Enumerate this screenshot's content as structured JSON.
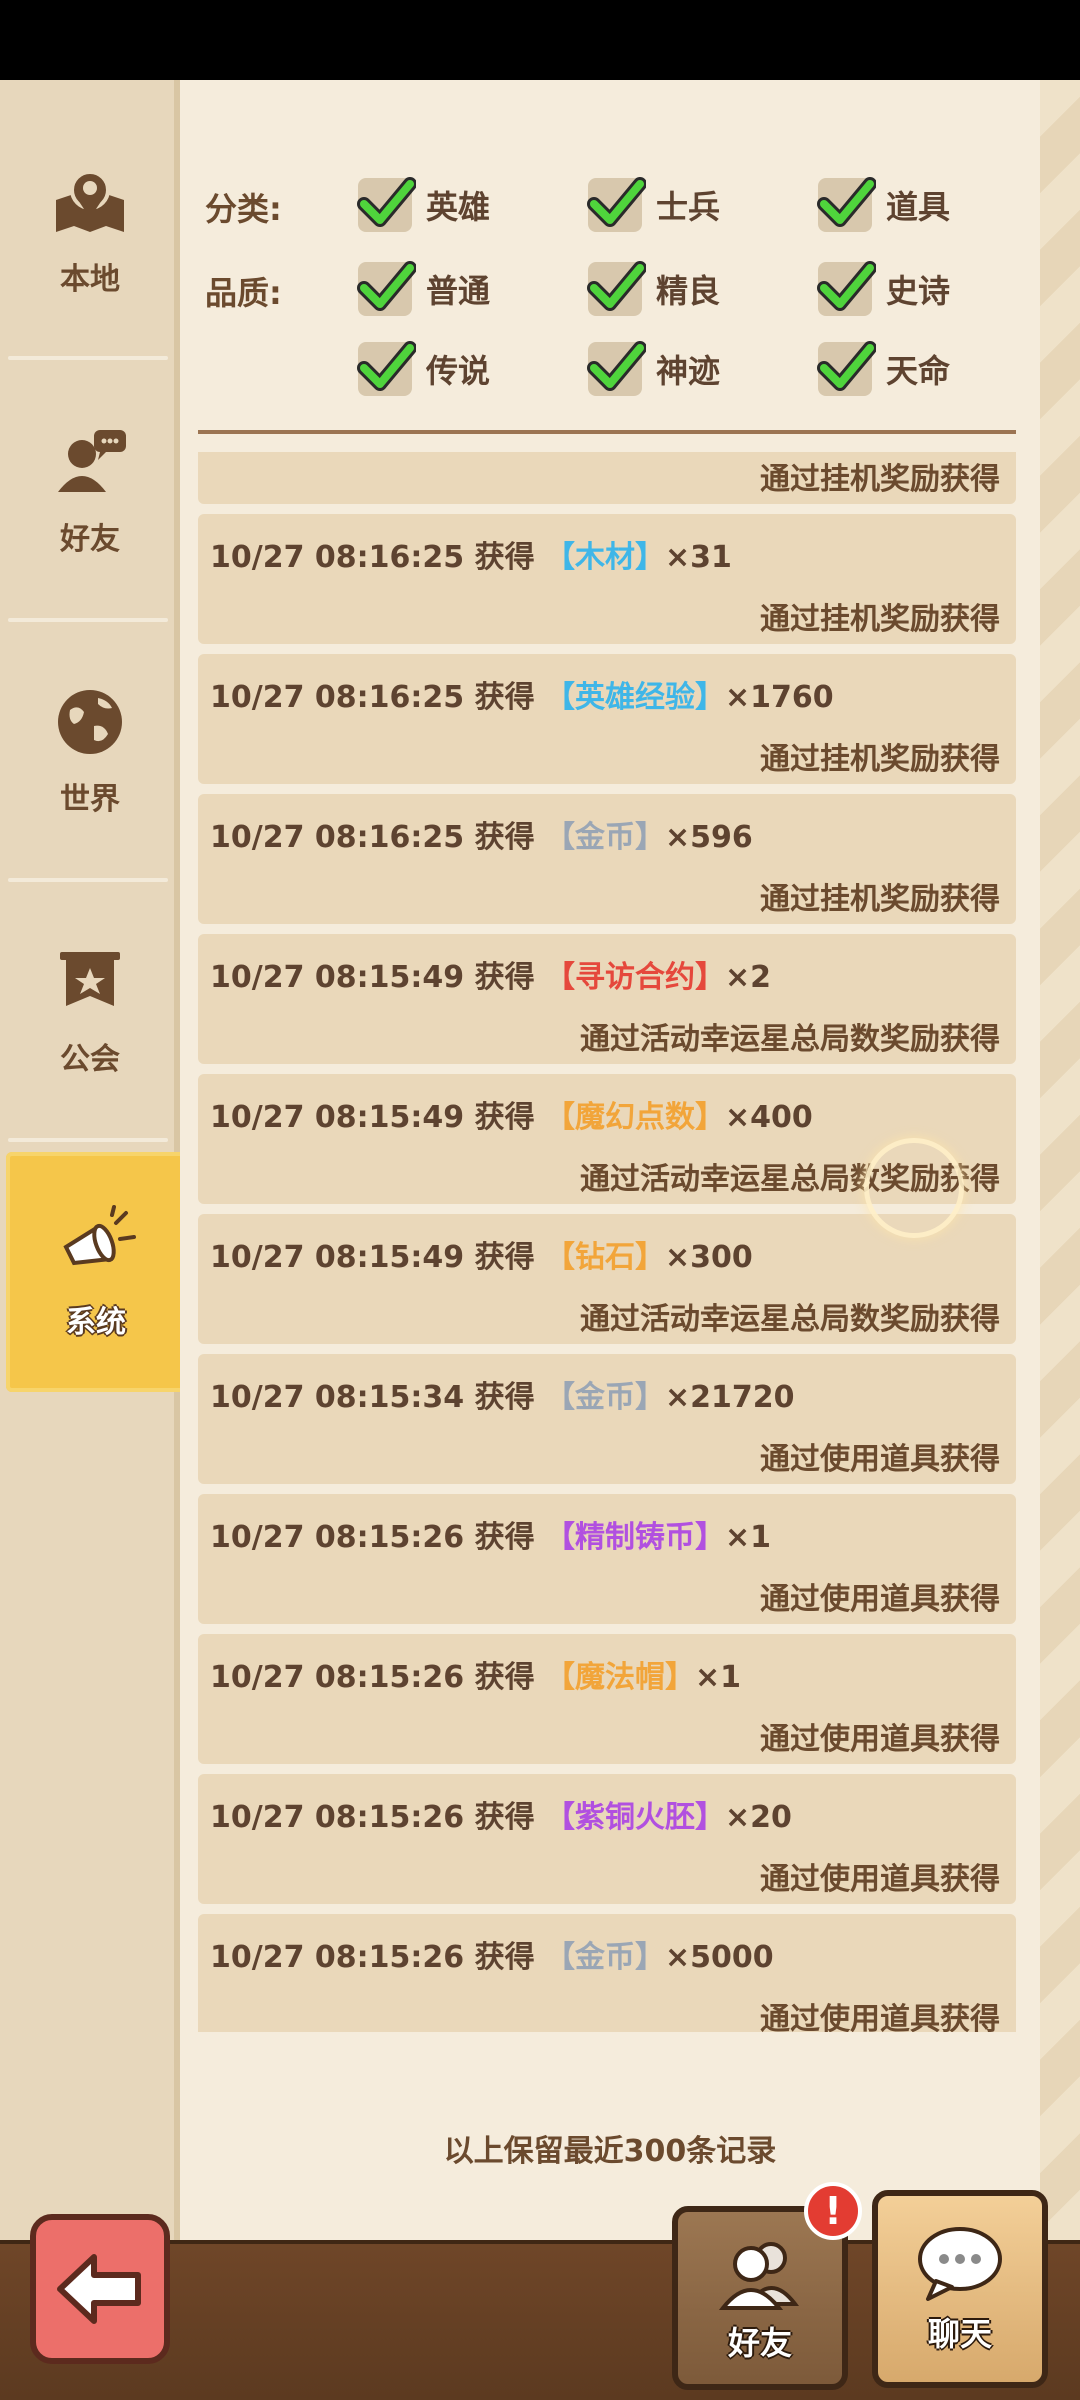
{
  "sidebar": {
    "tabs": [
      {
        "label": "本地",
        "icon": "map-pin-icon"
      },
      {
        "label": "好友",
        "icon": "friend-chat-icon"
      },
      {
        "label": "世界",
        "icon": "globe-icon"
      },
      {
        "label": "公会",
        "icon": "guild-banner-icon"
      },
      {
        "label": "系统",
        "icon": "megaphone-icon",
        "active": true
      }
    ]
  },
  "filters": {
    "category_label": "分类:",
    "quality_label": "品质:",
    "categories": [
      "英雄",
      "士兵",
      "道具"
    ],
    "qualities": [
      "普通",
      "精良",
      "史诗",
      "传说",
      "神迹",
      "天命"
    ]
  },
  "log": {
    "partial_top_source": "通过挂机奖励获得",
    "entries": [
      {
        "time": "10/27 08:16:25",
        "verb": "获得",
        "item": "【木材】",
        "item_color": "#3fb6e8",
        "qty": "×31",
        "source": "通过挂机奖励获得"
      },
      {
        "time": "10/27 08:16:25",
        "verb": "获得",
        "item": "【英雄经验】",
        "item_color": "#3fb6e8",
        "qty": "×1760",
        "source": "通过挂机奖励获得"
      },
      {
        "time": "10/27 08:16:25",
        "verb": "获得",
        "item": "【金币】",
        "item_color": "#9aa6b5",
        "qty": "×596",
        "source": "通过挂机奖励获得"
      },
      {
        "time": "10/27 08:15:49",
        "verb": "获得",
        "item": "【寻访合约】",
        "item_color": "#e5483c",
        "qty": "×2",
        "source": "通过活动幸运星总局数奖励获得"
      },
      {
        "time": "10/27 08:15:49",
        "verb": "获得",
        "item": "【魔幻点数】",
        "item_color": "#f2a53a",
        "qty": "×400",
        "source": "通过活动幸运星总局数奖励获得"
      },
      {
        "time": "10/27 08:15:49",
        "verb": "获得",
        "item": "【钻石】",
        "item_color": "#f2a53a",
        "qty": "×300",
        "source": "通过活动幸运星总局数奖励获得"
      },
      {
        "time": "10/27 08:15:34",
        "verb": "获得",
        "item": "【金币】",
        "item_color": "#9aa6b5",
        "qty": "×21720",
        "source": "通过使用道具获得"
      },
      {
        "time": "10/27 08:15:26",
        "verb": "获得",
        "item": "【精制铸币】",
        "item_color": "#b150e0",
        "qty": "×1",
        "source": "通过使用道具获得"
      },
      {
        "time": "10/27 08:15:26",
        "verb": "获得",
        "item": "【魔法帽】",
        "item_color": "#f2a53a",
        "qty": "×1",
        "source": "通过使用道具获得"
      },
      {
        "time": "10/27 08:15:26",
        "verb": "获得",
        "item": "【紫铜火胚】",
        "item_color": "#b150e0",
        "qty": "×20",
        "source": "通过使用道具获得"
      },
      {
        "time": "10/27 08:15:26",
        "verb": "获得",
        "item": "【金币】",
        "item_color": "#9aa6b5",
        "qty": "×5000",
        "source": "通过使用道具获得"
      }
    ],
    "footer_note": "以上保留最近300条记录"
  },
  "bottom": {
    "back_icon": "arrow-left-icon",
    "friend_label": "好友",
    "friend_alert": "!",
    "chat_label": "聊天"
  }
}
